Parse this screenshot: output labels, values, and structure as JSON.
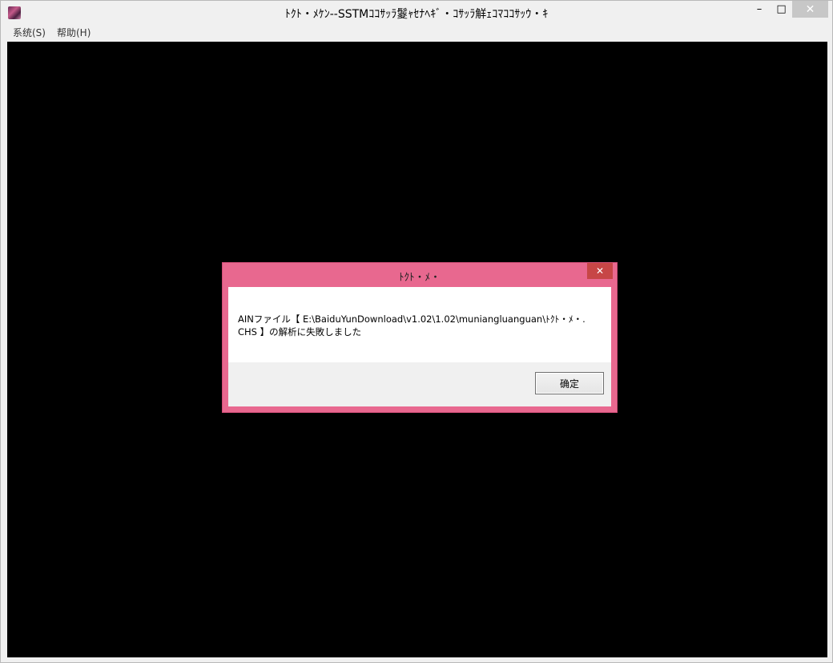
{
  "window": {
    "title": "ﾄｸﾄ・ﾒｹﾝ--SSTMｺｺｻｯﾗ鬉ｬｾﾅﾍｷﾞ・ｺｻｯﾗ觧ｪｺﾏｺｺｻｯｳ・ｷ",
    "minimize_glyph": "–",
    "maximize_glyph": "□",
    "close_glyph": "✕"
  },
  "menu": {
    "items": [
      {
        "label": "系统(S)"
      },
      {
        "label": "帮助(H)"
      }
    ]
  },
  "dialog": {
    "title": "ﾄｸﾄ・ﾒ・",
    "close_glyph": "✕",
    "message": "AINファイル【 E:\\BaiduYunDownload\\v1.02\\1.02\\muniangluanguan\\ﾄｸﾄ・ﾒ・.CHS 】の解析に失敗しました",
    "ok_label": "确定"
  },
  "colors": {
    "dialog_frame": "#e8688f",
    "dialog_close": "#c74646",
    "client_background": "#000000"
  }
}
